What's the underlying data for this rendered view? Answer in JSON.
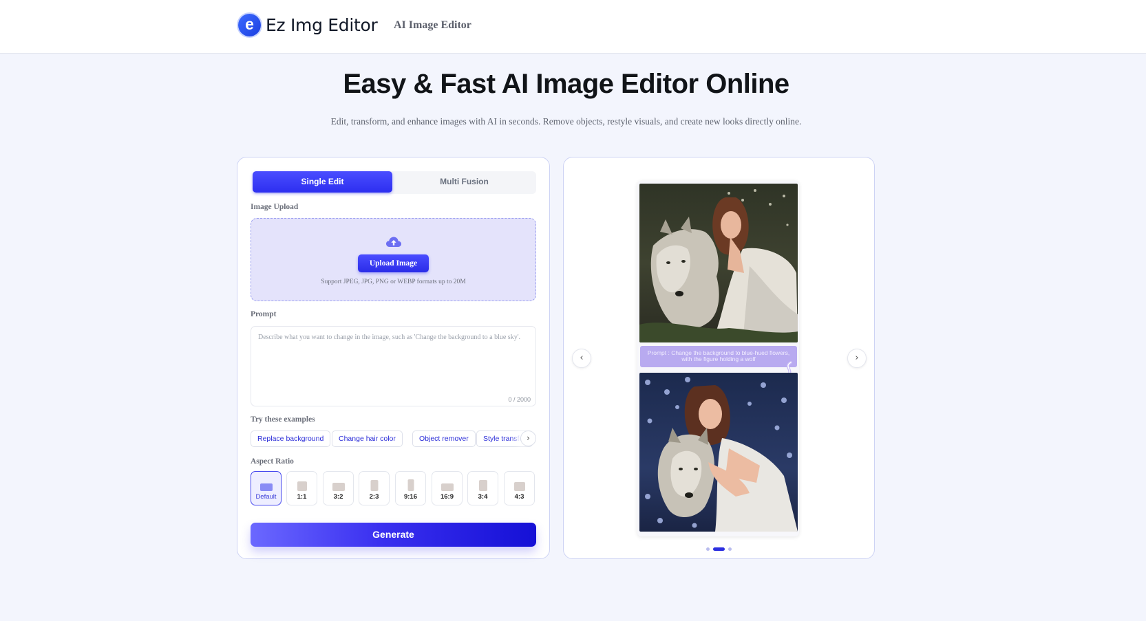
{
  "header": {
    "logo_letter": "e",
    "logo_text": "Ez Img Editor",
    "nav_link": "AI Image Editor"
  },
  "hero": {
    "title": "Easy & Fast AI Image Editor Online",
    "subtitle": "Edit, transform, and enhance images with AI in seconds. Remove objects, restyle visuals, and create new looks directly online."
  },
  "editor": {
    "tabs": [
      {
        "label": "Single Edit",
        "active": true
      },
      {
        "label": "Multi Fusion",
        "active": false
      }
    ],
    "upload": {
      "section_label": "Image Upload",
      "icon": "cloud-upload-icon",
      "button_label": "Upload Image",
      "hint": "Support JPEG, JPG, PNG or WEBP formats up to 20M"
    },
    "prompt": {
      "section_label": "Prompt",
      "value": "",
      "placeholder": "Describe what you want to change in the image, such as 'Change the background to a blue sky'.",
      "char_count": "0 / 2000"
    },
    "examples": {
      "section_label": "Try these examples",
      "chips": [
        "Replace background",
        "Change hair color",
        "Object remover",
        "Style transfer"
      ],
      "next_icon": "chevron-right-icon"
    },
    "aspect_ratio": {
      "section_label": "Aspect Ratio",
      "options": [
        "Default",
        "1:1",
        "3:2",
        "2:3",
        "9:16",
        "16:9",
        "3:4",
        "4:3"
      ],
      "selected": "Default"
    },
    "generate_label": "Generate"
  },
  "preview": {
    "prompt_text": "Prompt : Change the background to blue-hued flowers, with the figure holding a wolf",
    "prev_icon": "chevron-left-icon",
    "next_icon": "chevron-right-icon",
    "slide_count": 3,
    "active_slide": 2
  },
  "colors": {
    "accent": "#2d2ff0",
    "background": "#f3f5fd",
    "card_border": "#cdd3f4"
  }
}
